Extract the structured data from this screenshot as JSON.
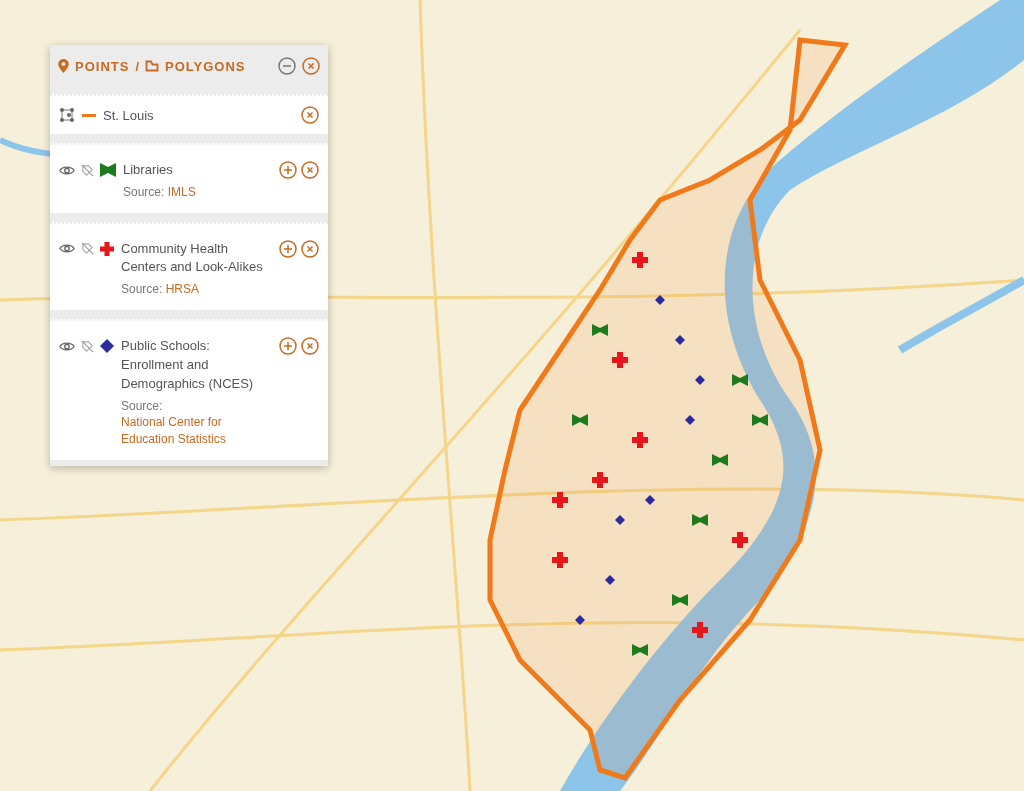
{
  "panel": {
    "tabs": [
      {
        "label": "POINTS",
        "kind": "points"
      },
      {
        "label": "/",
        "kind": "separator"
      },
      {
        "label": "POLYGONS",
        "kind": "polygons"
      }
    ],
    "polygons": [
      {
        "name": "St. Louis",
        "color": "#f07a1a"
      }
    ],
    "layers": [
      {
        "name": "Libraries",
        "source_label": "Source:",
        "source": "IMLS",
        "kind": "library",
        "color": "#1d7a1d"
      },
      {
        "name": "Community Health Centers and Look-Alikes",
        "source_label": "Source:",
        "source": "HRSA",
        "kind": "health",
        "color": "#e8151b"
      },
      {
        "name": "Public Schools: Enrollment and Demographics (NCES)",
        "source_label": "Source:",
        "source": "National Center for Education Statistics",
        "kind": "school",
        "color": "#2b2b9c"
      }
    ]
  }
}
